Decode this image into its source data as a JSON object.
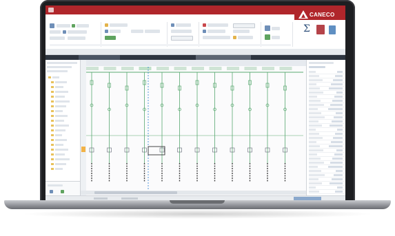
{
  "app": {
    "title": "CANECO",
    "brand": {
      "name": "CANECO",
      "color": "#b0262b"
    }
  },
  "tree": {
    "items": 20
  },
  "properties": {
    "rows": 30
  },
  "canvas": {
    "columns": 12,
    "highlight_column": 3
  },
  "icons": [
    "logo-icon",
    "sigma-icon",
    "folder-icon",
    "save-icon"
  ],
  "colors": {
    "accent": "#b0262b",
    "wire_green": "#58a86f",
    "selection_blue": "#2a7fd4",
    "ribbon_bg": "#ffffff"
  }
}
